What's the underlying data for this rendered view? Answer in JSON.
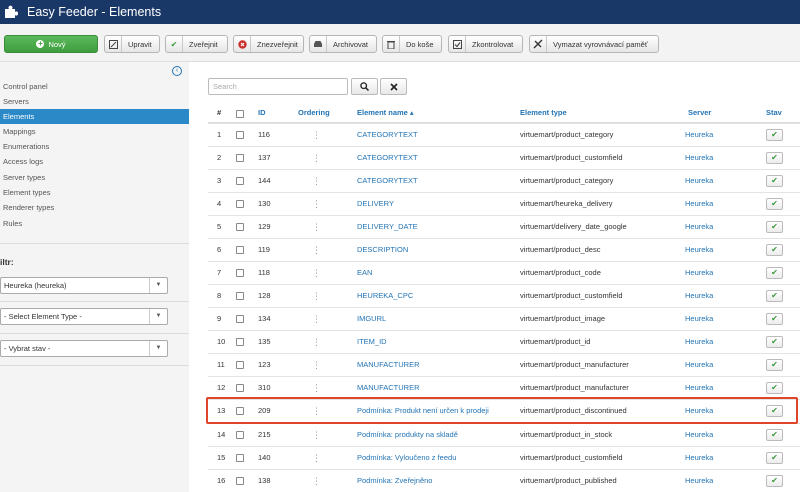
{
  "header": {
    "title": "Easy Feeder - Elements"
  },
  "toolbar": {
    "new_label": "Nový",
    "buttons": [
      {
        "label": "Upravit",
        "icon": "edit-icon"
      },
      {
        "label": "Zveřejnit",
        "icon": "check-icon"
      },
      {
        "label": "Znezveřejnit",
        "icon": "x-circle-icon"
      },
      {
        "label": "Archivovat",
        "icon": "archive-icon"
      },
      {
        "label": "Do koše",
        "icon": "trash-icon"
      },
      {
        "label": "Zkontrolovat",
        "icon": "checkbox-icon"
      },
      {
        "label": "Vymazat vyrovnávací paměť",
        "icon": "clear-cache-icon"
      }
    ]
  },
  "sidebar": {
    "items": [
      {
        "label": "Control panel",
        "active": false
      },
      {
        "label": "Servers",
        "active": false
      },
      {
        "label": "Elements",
        "active": true
      },
      {
        "label": "Mappings",
        "active": false
      },
      {
        "label": "Enumerations",
        "active": false
      },
      {
        "label": "Access logs",
        "active": false
      },
      {
        "label": "Server types",
        "active": false
      },
      {
        "label": "Element types",
        "active": false
      },
      {
        "label": "Renderer types",
        "active": false
      },
      {
        "label": "Rules",
        "active": false
      }
    ],
    "filter_label": "iltr:",
    "filters": {
      "server": "Heureka (heureka)",
      "element_type": "- Select Element Type -",
      "state": "- Vybrat stav -"
    }
  },
  "search": {
    "placeholder": "Search"
  },
  "table": {
    "headers": {
      "num": "#",
      "id": "ID",
      "ordering": "Ordering",
      "name": "Element name ▴",
      "type": "Element type",
      "server": "Server",
      "state": "Stav"
    },
    "rows": [
      {
        "num": "1",
        "id": "116",
        "name": "CATEGORYTEXT",
        "type": "virtuemart/product_category",
        "server": "Heureka"
      },
      {
        "num": "2",
        "id": "137",
        "name": "CATEGORYTEXT",
        "type": "virtuemart/product_customfield",
        "server": "Heureka"
      },
      {
        "num": "3",
        "id": "144",
        "name": "CATEGORYTEXT",
        "type": "virtuemart/product_category",
        "server": "Heureka"
      },
      {
        "num": "4",
        "id": "130",
        "name": "DELIVERY",
        "type": "virtuemart/heureka_delivery",
        "server": "Heureka"
      },
      {
        "num": "5",
        "id": "129",
        "name": "DELIVERY_DATE",
        "type": "virtuemart/delivery_date_google",
        "server": "Heureka"
      },
      {
        "num": "6",
        "id": "119",
        "name": "DESCRIPTION",
        "type": "virtuemart/product_desc",
        "server": "Heureka"
      },
      {
        "num": "7",
        "id": "118",
        "name": "EAN",
        "type": "virtuemart/product_code",
        "server": "Heureka"
      },
      {
        "num": "8",
        "id": "128",
        "name": "HEUREKA_CPC",
        "type": "virtuemart/product_customfield",
        "server": "Heureka"
      },
      {
        "num": "9",
        "id": "134",
        "name": "IMGURL",
        "type": "virtuemart/product_image",
        "server": "Heureka"
      },
      {
        "num": "10",
        "id": "135",
        "name": "ITEM_ID",
        "type": "virtuemart/product_id",
        "server": "Heureka"
      },
      {
        "num": "11",
        "id": "123",
        "name": "MANUFACTURER",
        "type": "virtuemart/product_manufacturer",
        "server": "Heureka"
      },
      {
        "num": "12",
        "id": "310",
        "name": "MANUFACTURER",
        "type": "virtuemart/product_manufacturer",
        "server": "Heureka"
      },
      {
        "num": "13",
        "id": "209",
        "name": "Podmínka: Produkt není určen k prodeji",
        "type": "virtuemart/product_discontinued",
        "server": "Heureka"
      },
      {
        "num": "14",
        "id": "215",
        "name": "Podmínka: produkty na skladě",
        "type": "virtuemart/product_in_stock",
        "server": "Heureka"
      },
      {
        "num": "15",
        "id": "140",
        "name": "Podmínka: Vyloučeno z feedu",
        "type": "virtuemart/product_customfield",
        "server": "Heureka"
      },
      {
        "num": "16",
        "id": "138",
        "name": "Podmínka: Zveřejněno",
        "type": "virtuemart/product_published",
        "server": "Heureka"
      }
    ]
  },
  "colors": {
    "header_bg": "#1a3867",
    "active_nav": "#2b89c8",
    "link": "#2374b5",
    "new_button": "#46a546",
    "highlight": "#e0452a"
  }
}
